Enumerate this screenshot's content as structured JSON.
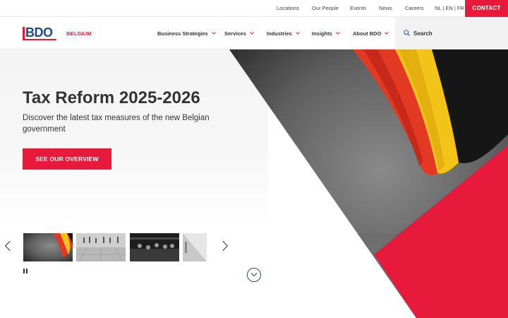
{
  "topbar": {
    "links": [
      "Locations",
      "Our People",
      "Events",
      "News",
      "Careers"
    ],
    "languages": "NL | EN | FR",
    "contact_label": "CONTACT"
  },
  "header": {
    "logo_text": "BDO",
    "country": "BELGIUM",
    "nav": [
      "Business Strategies",
      "Services",
      "Industries",
      "Insights",
      "About BDO"
    ],
    "search_label": "Search"
  },
  "hero": {
    "title": "Tax Reform 2025-2026",
    "subtitle": "Discover the latest tax measures of the new Belgian government",
    "cta_label": "SEE OUR OVERVIEW"
  },
  "colors": {
    "brand_red": "#e81a3b",
    "brand_blue": "#1d4a8b",
    "text": "#333333"
  },
  "icons": [
    "search-icon",
    "chevron-down-icon",
    "chevron-left-icon",
    "chevron-right-icon",
    "pause-icon",
    "scroll-down-icon"
  ]
}
